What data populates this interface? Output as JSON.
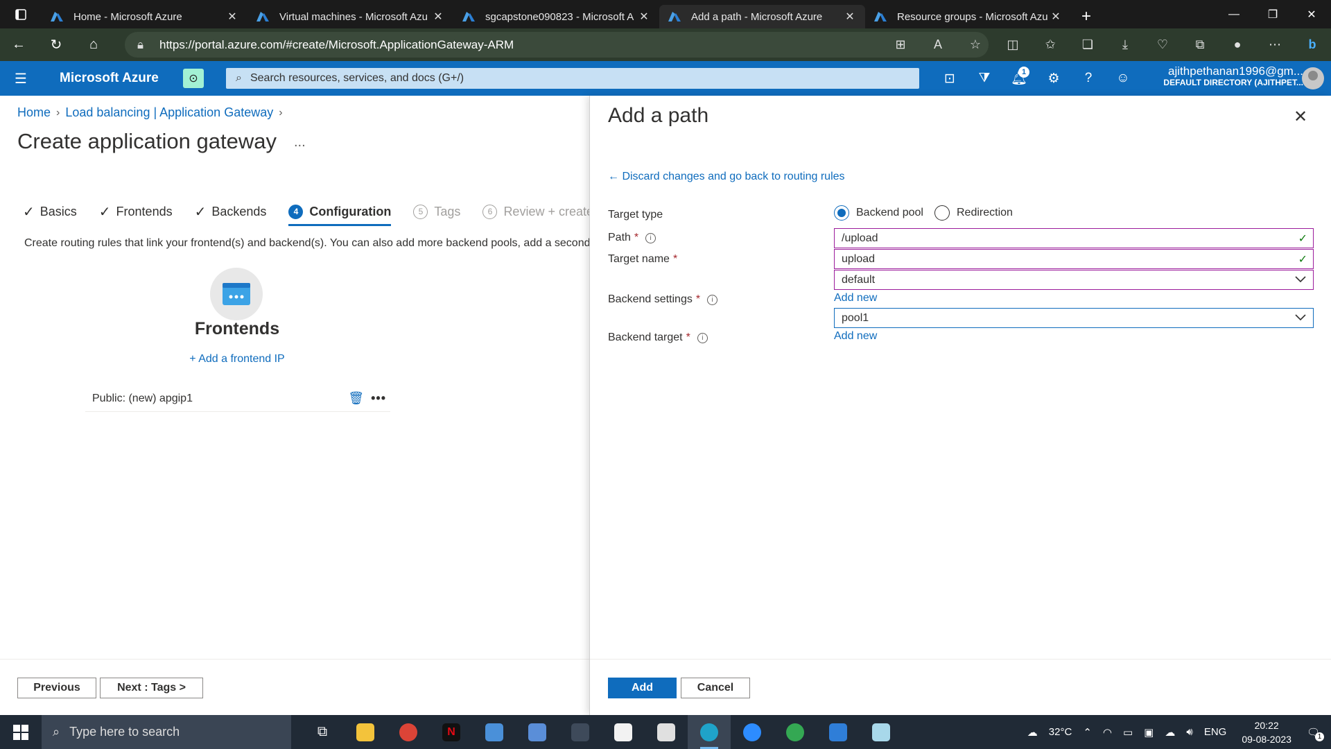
{
  "browser": {
    "tabs": [
      {
        "title": "Home - Microsoft Azure",
        "active": false
      },
      {
        "title": "Virtual machines - Microsoft Azu",
        "active": false
      },
      {
        "title": "sgcapstone090823 - Microsoft A",
        "active": false
      },
      {
        "title": "Add a path - Microsoft Azure",
        "active": true
      },
      {
        "title": "Resource groups - Microsoft Azu",
        "active": false
      }
    ],
    "url": "https://portal.azure.com/#create/Microsoft.ApplicationGateway-ARM"
  },
  "azure": {
    "brand": "Microsoft Azure",
    "search_placeholder": "Search resources, services, and docs (G+/)",
    "notification_count": "1",
    "account_email": "ajithpethanan1996@gm...",
    "account_directory": "DEFAULT DIRECTORY (AJITHPET..."
  },
  "breadcrumb": {
    "home": "Home",
    "parent": "Load balancing | Application Gateway"
  },
  "page": {
    "title": "Create application gateway",
    "more": "..."
  },
  "steps": [
    {
      "label": "Basics",
      "state": "done"
    },
    {
      "label": "Frontends",
      "state": "done"
    },
    {
      "label": "Backends",
      "state": "done"
    },
    {
      "num": "4",
      "label": "Configuration",
      "state": "current"
    },
    {
      "num": "5",
      "label": "Tags",
      "state": "disabled"
    },
    {
      "num": "6",
      "label": "Review + create",
      "state": "disabled"
    }
  ],
  "configuration": {
    "description": "Create routing rules that link your frontend(s) and backend(s). You can also add more backend pools, add a second",
    "frontends_title": "Frontends",
    "add_frontend": "+ Add a frontend IP",
    "frontend_item": "Public: (new) apgip1"
  },
  "footer": {
    "previous": "Previous",
    "next": "Next : Tags >"
  },
  "panel": {
    "title": "Add a path",
    "discard": "← Discard changes and go back to routing rules",
    "target_type_label": "Target type",
    "target_type_options": [
      "Backend pool",
      "Redirection"
    ],
    "target_type_selected": "Backend pool",
    "path_label": "Path",
    "path_value": "/upload",
    "target_name_label": "Target name",
    "target_name_value": "upload",
    "backend_settings_label": "Backend settings",
    "backend_settings_value": "default",
    "backend_settings_add": "Add new",
    "backend_target_label": "Backend target",
    "backend_target_value": "pool1",
    "backend_target_add": "Add new",
    "add_button": "Add",
    "cancel_button": "Cancel"
  },
  "taskbar": {
    "search_placeholder": "Type here to search",
    "temperature": "32°C",
    "language": "ENG",
    "time": "20:22",
    "date": "09-08-2023",
    "notification_count": "1"
  },
  "colors": {
    "azure_blue": "#0f6cbd",
    "field_border": "#9b1b9b",
    "valid_check": "#107c10"
  }
}
